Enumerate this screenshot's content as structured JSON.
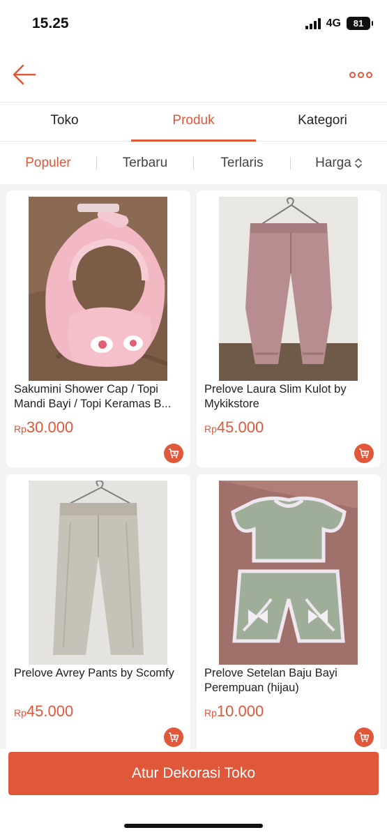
{
  "status_bar": {
    "time": "15.25",
    "network": "4G",
    "battery": "81"
  },
  "nav": {
    "back_icon": "arrow-left-icon",
    "more_icon": "more-options-icon"
  },
  "tabs": [
    {
      "label": "Toko"
    },
    {
      "label": "Produk",
      "active": true
    },
    {
      "label": "Kategori"
    }
  ],
  "sort": [
    {
      "label": "Populer",
      "active": true
    },
    {
      "label": "Terbaru"
    },
    {
      "label": "Terlaris"
    },
    {
      "label": "Harga",
      "icon": "sort-updown-icon"
    }
  ],
  "products": [
    {
      "title": "Sakumini Shower Cap / Topi Mandi Bayi / Topi Keramas B...",
      "currency": "Rp",
      "price": "30.000",
      "image": "pink-baby-shower-cap"
    },
    {
      "title": "Prelove Laura Slim Kulot by Mykikstore",
      "currency": "Rp",
      "price": "45.000",
      "image": "pink-kulot-pants"
    },
    {
      "title": "Prelove Avrey Pants by Scomfy",
      "currency": "Rp",
      "price": "45.000",
      "image": "beige-pants"
    },
    {
      "title": "Prelove Setelan Baju Bayi Perempuan (hijau)",
      "currency": "Rp",
      "price": "10.000",
      "image": "green-baby-outfit"
    }
  ],
  "cta": {
    "label": "Atur Dekorasi Toko"
  },
  "colors": {
    "accent": "#e0573a",
    "background": "#f3f3f3"
  }
}
